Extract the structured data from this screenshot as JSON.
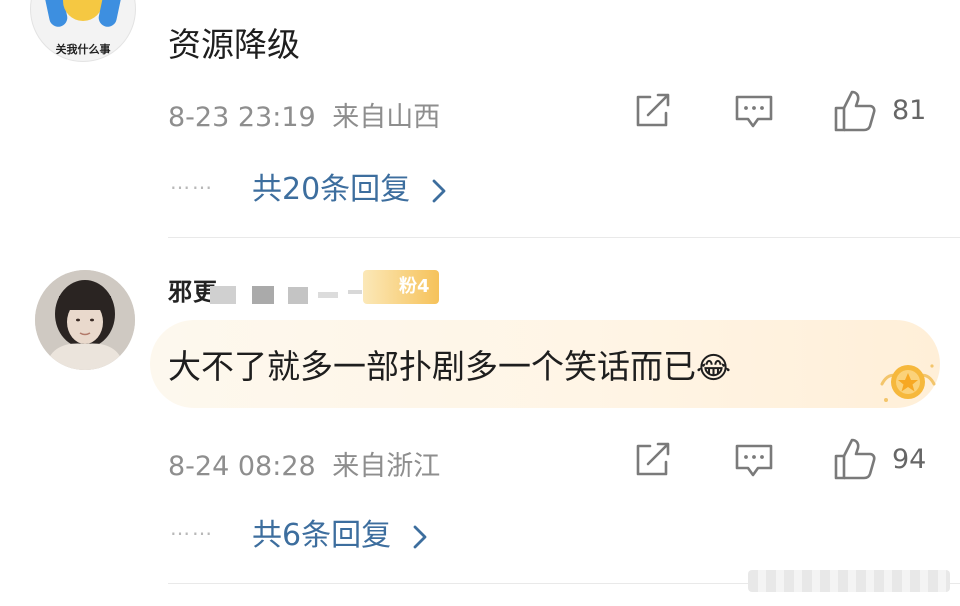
{
  "comments": [
    {
      "avatar_caption": "关我什么事",
      "text": "资源降级",
      "time": "8-23 23:19",
      "location": "来自山西",
      "likes": "81",
      "reply_link": "共20条回复",
      "reply_dots": "……"
    },
    {
      "username": "邪更",
      "fan_badge": "粉4",
      "text": "大不了就多一部扑剧多一个笑话而已",
      "emoji": "😂",
      "time": "8-24 08:28",
      "location": "来自浙江",
      "likes": "94",
      "reply_link": "共6条回复",
      "reply_dots": "……"
    }
  ],
  "icons": {
    "share": "share-icon",
    "comment": "comment-icon",
    "like": "thumbs-up-icon",
    "chevron": "chevron-right-icon"
  },
  "colors": {
    "link": "#3d6e9e",
    "meta": "#8e8e8e",
    "bubble": "#fff5e6"
  }
}
